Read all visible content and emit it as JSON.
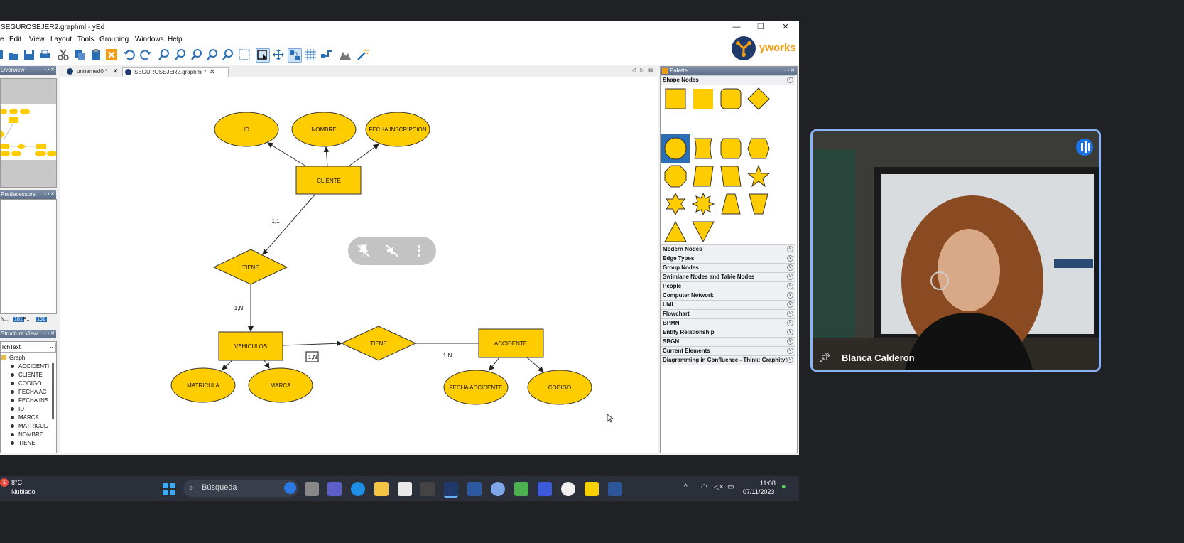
{
  "window": {
    "title": "SEGUROSEJER2.graphml - yEd",
    "controls": [
      "—",
      "❐",
      "✕"
    ]
  },
  "menu": [
    "e",
    "Edit",
    "View",
    "Layout",
    "Tools",
    "Grouping",
    "Windows",
    "Help"
  ],
  "brand": {
    "name": "yworks",
    "color": "#f39c12"
  },
  "panes": {
    "overview": "Overview",
    "predecessors": "Predecessors",
    "structure": "Structure View",
    "structure_filter": "rchText",
    "bottom_tabs": [
      "N...",
      "P...",
      ""
    ]
  },
  "tree": {
    "root": "Graph",
    "items": [
      "ACCIDENTI",
      "CLIENTE",
      "CODIGO",
      "FECHA AC",
      "FECHA INS",
      "ID",
      "MARCA",
      "MATRICUL/",
      "NOMBRE",
      "TIENE"
    ]
  },
  "doc_tabs": [
    {
      "label": "unnamed0 *",
      "active": false
    },
    {
      "label": "SEGUROSEJER2.graphml *",
      "active": true
    }
  ],
  "diagram": {
    "entities": {
      "cliente": "CLIENTE",
      "vehiculos": "VEHICULOS",
      "accidente": "ACCIDENTE"
    },
    "relations": {
      "tiene1": "TIENE",
      "tiene2": "TIENE"
    },
    "attributes": {
      "id": "ID",
      "nombre": "NOMBRE",
      "fecha_inscripcion": "FECHA INSCRIPCION",
      "matricula": "MATRICULA",
      "marca": "MARCA",
      "fecha_accidente": "FECHA ACCIDENTE",
      "codigo": "CODIGO"
    },
    "cardinalities": {
      "c1": "1,1",
      "c2": "1,N",
      "c3": "1,N",
      "c4": "1,N"
    },
    "node_fill": "#ffcc00",
    "node_stroke": "#333333"
  },
  "palette": {
    "title": "Palette",
    "open_section": "Shape Nodes",
    "sections": [
      "Modern Nodes",
      "Edge Types",
      "Group Nodes",
      "Swimlane Nodes and Table Nodes",
      "People",
      "Computer Network",
      "UML",
      "Flowchart",
      "BPMN",
      "Entity Relationship",
      "SBGN",
      "Current Elements",
      "Diagramming in Confluence - Think: Graphity!"
    ]
  },
  "taskbar": {
    "weather_temp": "8°C",
    "weather_desc": "Nublado",
    "search_placeholder": "Búsqueda",
    "time": "11:08",
    "date": "07/11/2023"
  },
  "meeting": {
    "participant": "Blanca Calderon"
  }
}
